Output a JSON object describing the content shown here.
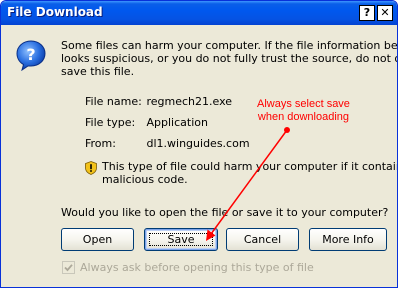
{
  "window": {
    "title": "File Download",
    "help_glyph": "?",
    "close_glyph": "✕"
  },
  "message": {
    "line1": "Some files can harm your computer. If the file information below",
    "line2": "looks suspicious, or you do not fully trust the source, do not open or",
    "line3": "save this file."
  },
  "file_info": {
    "name_label": "File name:",
    "name_value": "regmech21.exe",
    "type_label": "File type:",
    "type_value": "Application",
    "from_label": "From:",
    "from_value": "dl1.winguides.com"
  },
  "warning": {
    "line1": "This type of file could harm your computer if it contains",
    "line2": "malicious code."
  },
  "question": "Would you like to open the file or save it to your computer?",
  "buttons": {
    "open": "Open",
    "save": "Save",
    "cancel": "Cancel",
    "more_info": "More Info"
  },
  "checkbox": {
    "label": "Always ask before opening this type of file",
    "checked": true,
    "disabled": true
  },
  "annotation": {
    "line1": "Always select save",
    "line2": "when downloading",
    "color": "#ff0000"
  },
  "colors": {
    "titlebar": "#0058ee",
    "dialog_bg": "#ece9d8",
    "button_border": "#003c74"
  },
  "icons": {
    "dialog": "question-icon",
    "warning": "shield-icon",
    "arrow": "annotation-arrow"
  }
}
